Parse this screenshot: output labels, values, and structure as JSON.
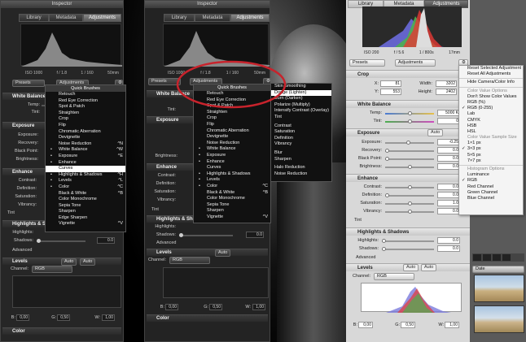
{
  "left": {
    "title": "Inspector",
    "tabs": [
      "Library",
      "Metadata",
      "Adjustments"
    ],
    "meta": [
      "ISO 1000",
      "f / 1.8",
      "1 / 160",
      "50mm"
    ],
    "presets": "Presets",
    "adjustments": "Adjustments",
    "sections": [
      "White Balance",
      "Exposure",
      "Enhance",
      "Highlights & Shadows",
      "Levels",
      "Color"
    ],
    "wb": {
      "temp": "Temp:",
      "tint": "Tint:"
    },
    "exposure": {
      "exposure": "Exposure:",
      "recovery": "Recovery:",
      "black": "Black Point:",
      "brightness": "Brightness:"
    },
    "enhance": {
      "contrast": "Contrast:",
      "definition": "Definition:",
      "saturation": "Saturation:",
      "vibrancy": "Vibrancy:",
      "tint": "Tint"
    },
    "hs": {
      "highlights": "Highlights:",
      "shadows": "Shadows:",
      "shadows_val": "0.0",
      "advanced": "Advanced"
    },
    "levels": {
      "auto1": "Auto",
      "auto2": "Auto",
      "channel": "Channel:",
      "rgb": "RGB",
      "b": "B:",
      "bval": "0,00",
      "g": "G:",
      "gval": "0,50",
      "w": "W:",
      "wval": "1,00"
    },
    "menu": {
      "header": "Quick Brushes",
      "items": [
        {
          "label": "Retouch",
          "sc": ""
        },
        {
          "label": "Red Eye Correction",
          "sc": ""
        },
        {
          "label": "Spot & Patch",
          "sc": ""
        },
        {
          "label": "Straighten",
          "sc": ""
        },
        {
          "label": "Crop",
          "sc": ""
        },
        {
          "label": "Flip",
          "sc": ""
        },
        {
          "label": "Chromatic Aberration",
          "sc": ""
        },
        {
          "label": "Devignette",
          "sc": ""
        },
        {
          "label": "Noise Reduction",
          "sc": "^N"
        },
        {
          "label": "White Balance",
          "sc": "^W",
          "ck": "•"
        },
        {
          "label": "Exposure",
          "sc": "^E",
          "ck": "•"
        },
        {
          "label": "Enhance",
          "sc": "",
          "ck": "•"
        },
        {
          "label": "Curves",
          "sc": "",
          "hl": true
        },
        {
          "label": "Highlights & Shadows",
          "sc": "^H",
          "ck": "•"
        },
        {
          "label": "Levels",
          "sc": "^L",
          "ck": "•"
        },
        {
          "label": "Color",
          "sc": "^C",
          "ck": "•"
        },
        {
          "label": "Black & White",
          "sc": "^B"
        },
        {
          "label": "Color Monochrome",
          "sc": ""
        },
        {
          "label": "Sepia Tone",
          "sc": ""
        },
        {
          "label": "Sharpen",
          "sc": ""
        },
        {
          "label": "Edge Sharpen",
          "sc": ""
        },
        {
          "label": "Vignette",
          "sc": "^V"
        }
      ]
    }
  },
  "middle": {
    "title": "Inspector",
    "tabs": [
      "Library",
      "Metadata",
      "Adjustments"
    ],
    "meta": [
      "ISO 1000",
      "f / 1.8",
      "1 / 160",
      "50mm"
    ],
    "presets": "Presets",
    "adjustments": "Adjustments",
    "sections": [
      "White Balance",
      "Exposure",
      "Enhance",
      "Highlights & Shadows",
      "Levels",
      "Color"
    ],
    "hs": {
      "highlights": "Highlights:",
      "shadows": "Shadows:",
      "shadows_val": "0.0",
      "advanced": "Advanced"
    },
    "levels": {
      "auto1": "Auto",
      "channel": "Channel:",
      "rgb": "RGB",
      "b": "B:",
      "bval": "0,00",
      "g": "G:",
      "gval": "0,50",
      "w": "W:",
      "wval": "1,00"
    },
    "wb": {
      "tint": "Tint:"
    },
    "exposure": {
      "brightness": "Brightness:"
    },
    "enhance": {
      "contrast": "Contrast:",
      "definition": "Definition:",
      "saturation": "Saturation:",
      "vibrancy": "Vibrancy:",
      "tint": "Tint"
    },
    "menu": {
      "header": "Quick Brushes",
      "items": [
        {
          "label": "Retouch",
          "sc": ""
        },
        {
          "label": "Red Eye Correction",
          "sc": ""
        },
        {
          "label": "Spot & Patch",
          "sc": ""
        },
        {
          "label": "Straighten",
          "sc": ""
        },
        {
          "label": "Crop",
          "sc": ""
        },
        {
          "label": "Flip",
          "sc": ""
        },
        {
          "label": "Chromatic Aberration",
          "sc": ""
        },
        {
          "label": "Devignette",
          "sc": ""
        },
        {
          "label": "Noise Reduction",
          "sc": ""
        },
        {
          "label": "White Balance",
          "sc": "",
          "ck": "•"
        },
        {
          "label": "Exposure",
          "sc": "",
          "ck": "•"
        },
        {
          "label": "Enhance",
          "sc": "",
          "ck": "•"
        },
        {
          "label": "Curves",
          "sc": ""
        },
        {
          "label": "Highlights & Shadows",
          "sc": "",
          "ck": "•"
        },
        {
          "label": "Levels",
          "sc": "",
          "ck": "•"
        },
        {
          "label": "Color",
          "sc": "^C",
          "ck": "•"
        },
        {
          "label": "Black & White",
          "sc": "^B"
        },
        {
          "label": "Color Monochrome",
          "sc": ""
        },
        {
          "label": "Sepia Tone",
          "sc": ""
        },
        {
          "label": "Sharpen",
          "sc": ""
        },
        {
          "label": "Vignette",
          "sc": "^V"
        }
      ]
    },
    "submenu": {
      "items": [
        {
          "label": "Skin Smoothing"
        },
        {
          "label": "Dodge (Lighten)",
          "hl": true
        },
        {
          "label": "Burn (Darken)"
        },
        {
          "label": "Polarize (Multiply)"
        },
        {
          "label": "Intensify Contrast (Overlay)"
        },
        {
          "label": "Tint"
        },
        {
          "sep": true
        },
        {
          "label": "Contrast"
        },
        {
          "label": "Saturation"
        },
        {
          "label": "Definition"
        },
        {
          "label": "Vibrancy"
        },
        {
          "sep": true
        },
        {
          "label": "Blur"
        },
        {
          "label": "Sharpen"
        },
        {
          "sep": true
        },
        {
          "label": "Halo Reduction"
        },
        {
          "label": "Noise Reduction"
        }
      ]
    }
  },
  "right": {
    "tabs": [
      "Library",
      "Metadata",
      "Adjustments"
    ],
    "meta": [
      "ISO 200",
      "f / 5.6",
      "1 / 800s",
      "17mm"
    ],
    "presets": "Presets",
    "adjustments": "Adjustments",
    "crop": {
      "title": "Crop",
      "x": "X:",
      "xval": "81",
      "y": "Y:",
      "yval": "553",
      "width": "Width:",
      "wval": "3202",
      "height": "Height:",
      "hval": "2402"
    },
    "wb": {
      "title": "White Balance",
      "temp": "Temp:",
      "tempval": "5000 K",
      "tint": "Tint:",
      "tintval": "0"
    },
    "exposure": {
      "title": "Exposure",
      "auto": "Auto",
      "exposure": "Exposure:",
      "expval": "-0.25",
      "recovery": "Recovery:",
      "recval": "0.0",
      "black": "Black Point:",
      "blackval": "0.0",
      "brightness": "Brightness:",
      "brightval": "0.0"
    },
    "enhance": {
      "title": "Enhance",
      "contrast": "Contrast:",
      "conval": "0.0",
      "definition": "Definition:",
      "defval": "0.0",
      "saturation": "Saturation:",
      "satval": "1.0",
      "vibrancy": "Vibrancy:",
      "vibval": "0.0",
      "tint": "Tint"
    },
    "hs": {
      "title": "Highlights & Shadows",
      "highlights": "Highlights:",
      "hval": "0.0",
      "shadows": "Shadows:",
      "sval": "0.0",
      "advanced": "Advanced"
    },
    "levels": {
      "title": "Levels",
      "auto1": "Auto",
      "auto2": "Auto",
      "channel": "Channel:",
      "rgb": "RGB",
      "b": "B:",
      "bval": "0,00",
      "g": "G:",
      "gval": "0,50",
      "w": "W:",
      "wval": "1,00"
    },
    "browser": {
      "date": "Date"
    },
    "menu": [
      {
        "label": "Reset Selected Adjustment"
      },
      {
        "label": "Reset All Adjustments"
      },
      {
        "sep": true
      },
      {
        "label": "Hide Camera/Color Info"
      },
      {
        "sep": true
      },
      {
        "label": "Color Value Options",
        "dis": true
      },
      {
        "label": "Don't Show Color Values"
      },
      {
        "label": "RGB (%)"
      },
      {
        "label": "RGB (0-255)",
        "ck": "✓"
      },
      {
        "label": "Lab"
      },
      {
        "label": "CMYK"
      },
      {
        "label": "HSB"
      },
      {
        "label": "HSL"
      },
      {
        "label": "Color Value Sample Size",
        "dis": true
      },
      {
        "label": "1×1 px"
      },
      {
        "label": "3×3 px",
        "ck": "✓"
      },
      {
        "label": "5×5 px"
      },
      {
        "label": "7×7 px"
      },
      {
        "sep": true
      },
      {
        "label": "Histogram Options",
        "dis": true
      },
      {
        "label": "Luminance"
      },
      {
        "label": "RGB",
        "ck": "✓"
      },
      {
        "label": "Red Channel"
      },
      {
        "label": "Green Channel"
      },
      {
        "label": "Blue Channel"
      }
    ]
  }
}
